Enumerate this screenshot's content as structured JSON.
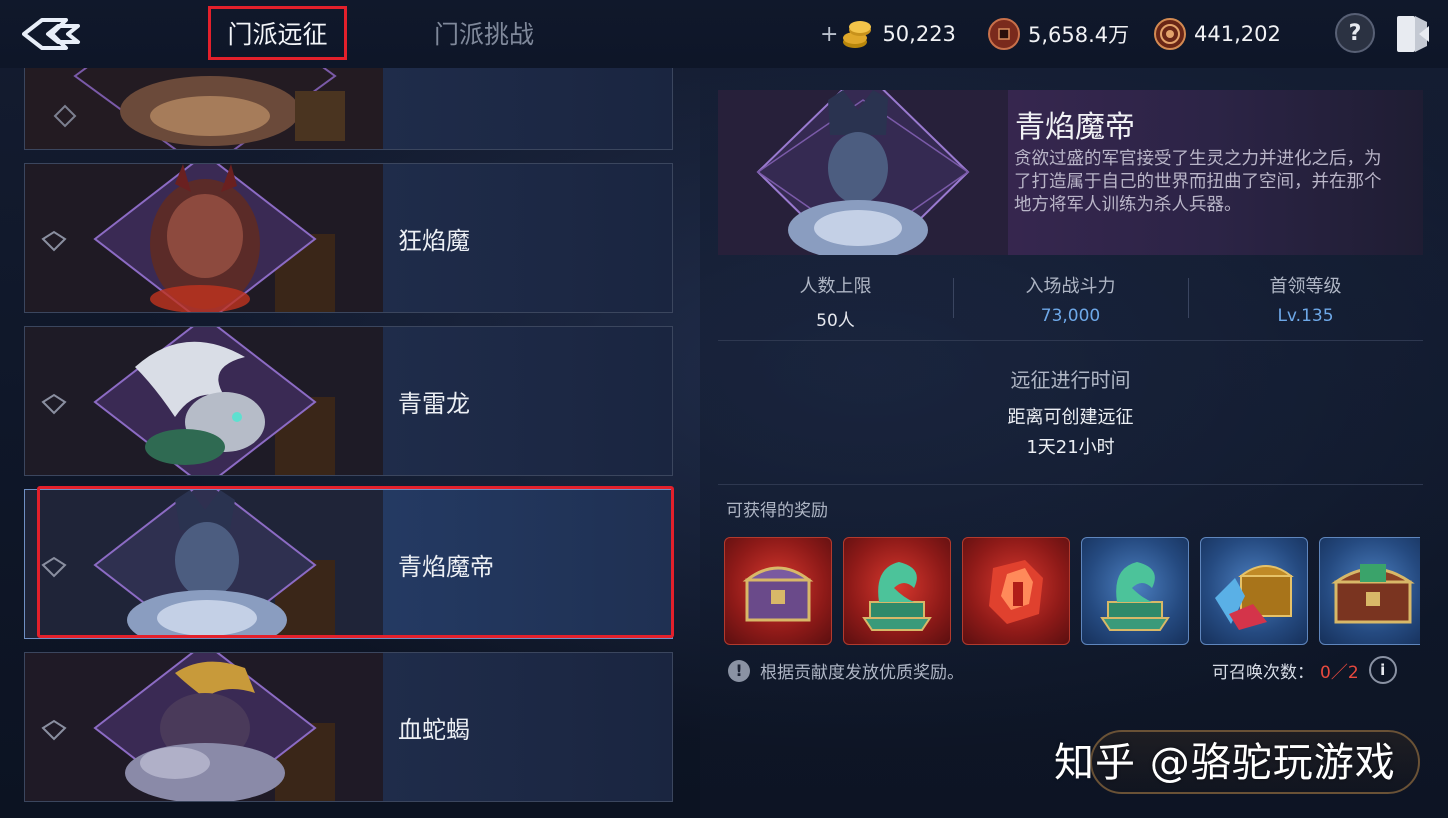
{
  "topbar": {
    "back_icon": "back-arrow-icon",
    "tabs": [
      {
        "label": "门派远征",
        "active": true
      },
      {
        "label": "门派挑战",
        "active": false
      }
    ],
    "currencies": [
      {
        "icon": "gold-coins-icon",
        "value": "50,223",
        "has_plus": true,
        "plus": "+"
      },
      {
        "icon": "bronze-coin-icon",
        "value": "5,658.4万"
      },
      {
        "icon": "medallion-icon",
        "value": "441,202"
      }
    ],
    "help_label": "?",
    "exit_icon": "exit-door-icon"
  },
  "boss_list": [
    {
      "name": "",
      "star": false
    },
    {
      "name": "狂焰魔",
      "star": false
    },
    {
      "name": "青雷龙",
      "star": false
    },
    {
      "name": "青焰魔帝",
      "star": false,
      "selected": true
    },
    {
      "name": "血蛇蝎",
      "star": false
    }
  ],
  "detail": {
    "title": "青焰魔帝",
    "description": "贪欲过盛的军官接受了生灵之力并进化之后，为了打造属于自己的世界而扭曲了空间，并在那个地方将军人训练为杀人兵器。",
    "stats": [
      {
        "label": "人数上限",
        "value": "50人"
      },
      {
        "label": "入场战斗力",
        "value": "73,000"
      },
      {
        "label": "首领等级",
        "value": "Lv.135"
      }
    ],
    "time": {
      "title": "远征进行时间",
      "subtitle": "距离可创建远征",
      "value": "1天21小时"
    },
    "rewards_label": "可获得的奖励",
    "rewards": [
      {
        "icon": "purple-chest-icon",
        "frame": "red"
      },
      {
        "icon": "jade-dragon-seal-icon",
        "frame": "red"
      },
      {
        "icon": "red-crystal-icon",
        "frame": "red"
      },
      {
        "icon": "jade-dragon-seal-icon",
        "frame": "blue"
      },
      {
        "icon": "gem-chest-icon",
        "frame": "blue"
      },
      {
        "icon": "green-chest-icon",
        "frame": "blue"
      }
    ],
    "notice": "根据贡献度发放优质奖励。",
    "notice_icon": "!",
    "summon_label": "可召唤次数：",
    "summon_count": "0／2",
    "summon_info": "i"
  },
  "watermark": "知乎 @骆驼玩游戏",
  "colors": {
    "accent_red": "#e3202b",
    "value_blue": "#6ea8e8",
    "summon_red": "#e8493e"
  }
}
